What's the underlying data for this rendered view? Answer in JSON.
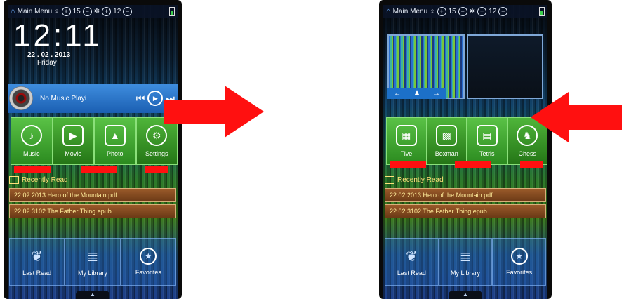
{
  "left_phone": {
    "status": {
      "menu_label": "Main Menu",
      "left_value": "15",
      "right_value": "12"
    },
    "clock": {
      "time": "12:11",
      "date": "22 . 02 . 2013",
      "day": "Friday"
    },
    "music": {
      "title": "No Music Playi"
    },
    "apps": [
      {
        "label": "Music",
        "icon": "music-icon"
      },
      {
        "label": "Movie",
        "icon": "movie-icon"
      },
      {
        "label": "Photo",
        "icon": "photo-icon"
      },
      {
        "label": "Settings",
        "icon": "settings-icon"
      }
    ],
    "recently_read_label": "Recently Read",
    "recent": [
      "22.02.2013   Hero of the Mountain.pdf",
      "22.02.3102   The Father Thing.epub"
    ],
    "bottom": [
      {
        "label": "Last Read",
        "icon": "book-icon"
      },
      {
        "label": "My Library",
        "icon": "library-icon"
      },
      {
        "label": "Favorites",
        "icon": "star-icon"
      }
    ]
  },
  "right_phone": {
    "status": {
      "menu_label": "Main Menu",
      "left_value": "15",
      "right_value": "12"
    },
    "apps": [
      {
        "label": "Five",
        "icon": "grid-icon"
      },
      {
        "label": "Boxman",
        "icon": "boxes-icon"
      },
      {
        "label": "Tetris",
        "icon": "tetris-icon"
      },
      {
        "label": "Chess",
        "icon": "chess-icon"
      }
    ],
    "recently_read_label": "Recently Read",
    "recent": [
      "22.02.2013   Hero of the Mountain.pdf",
      "22.02.3102   The Father Thing.epub"
    ],
    "bottom": [
      {
        "label": "Last Read",
        "icon": "book-icon"
      },
      {
        "label": "My Library",
        "icon": "library-icon"
      },
      {
        "label": "Favorites",
        "icon": "star-icon"
      }
    ]
  },
  "colors": {
    "arrow": "#ff1010",
    "app_tile": "#3fa52e",
    "recent_row": "#8a4e22"
  }
}
